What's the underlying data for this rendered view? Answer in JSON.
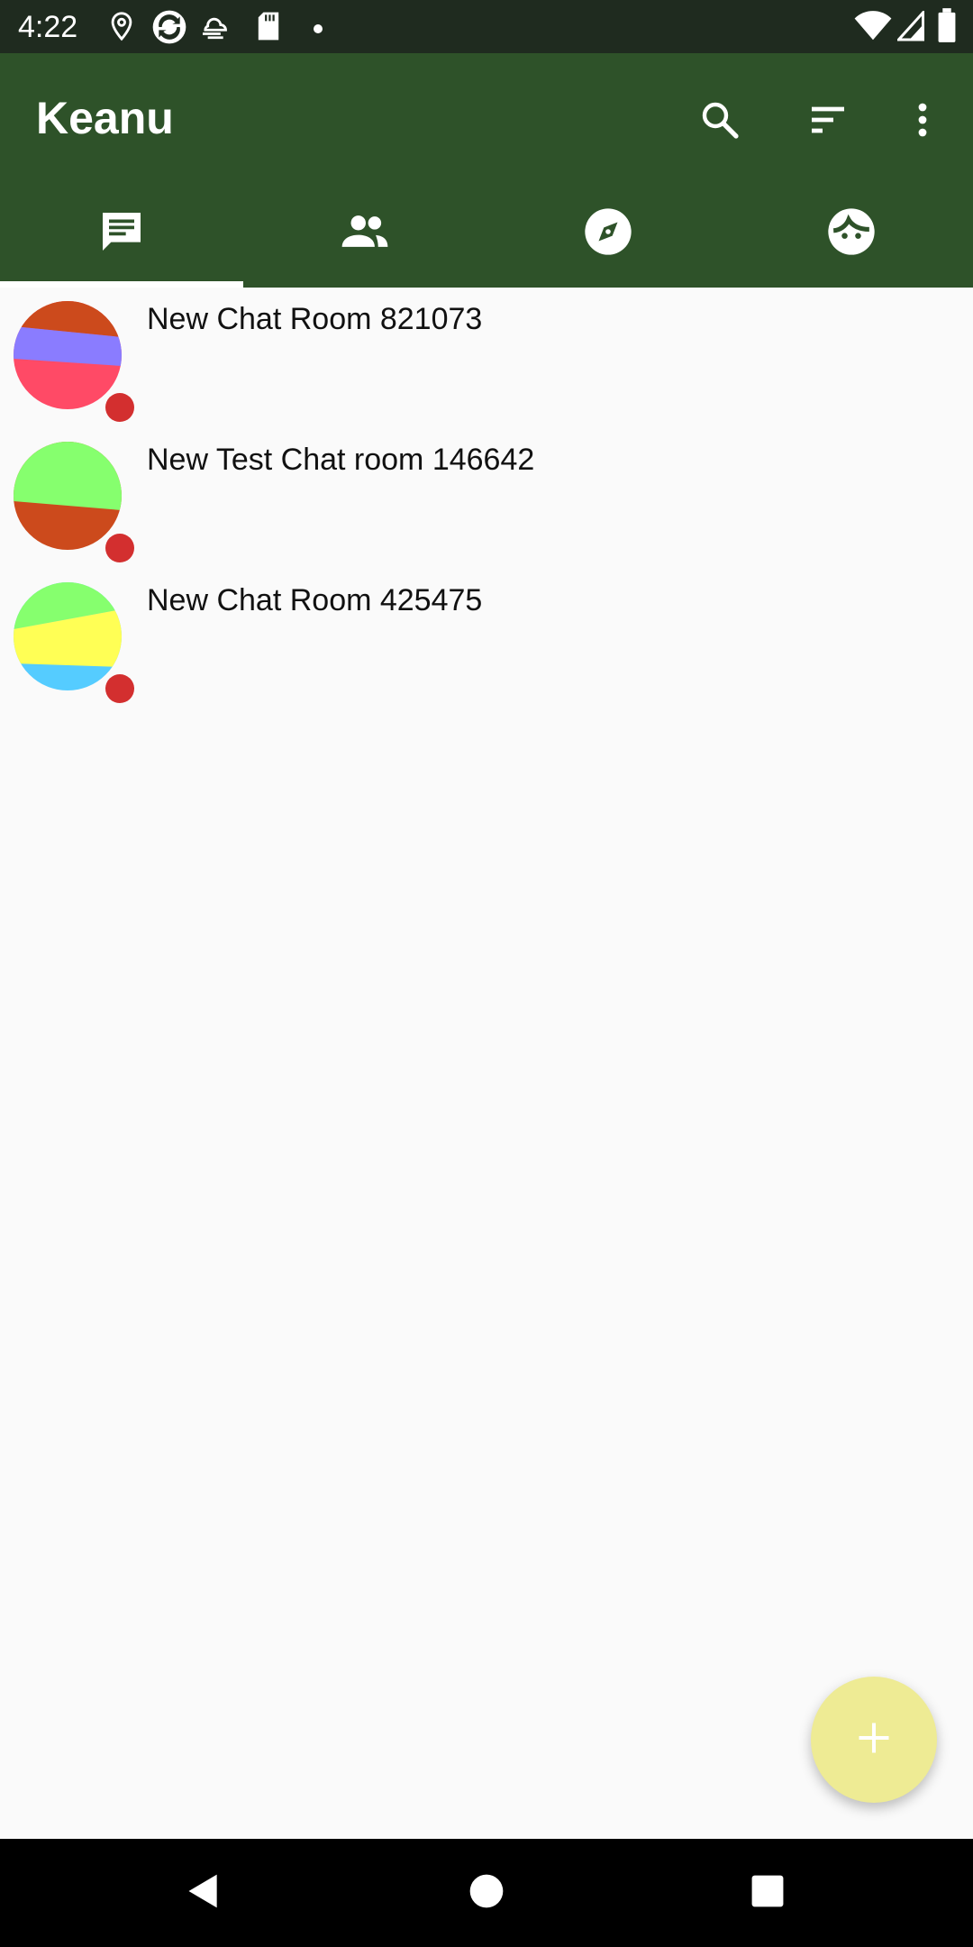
{
  "status_bar": {
    "time": "4:22",
    "left_icons": [
      "location-icon",
      "sync-app-icon",
      "cloud-wind-icon",
      "sd-card-icon",
      "notification-dot-icon"
    ],
    "right_icons": [
      "wifi-icon",
      "signal-icon",
      "battery-icon"
    ]
  },
  "app_bar": {
    "title": "Keanu",
    "actions": [
      "search-icon",
      "sort-icon",
      "more-vert-icon"
    ],
    "color": "#2e5229"
  },
  "tabs": [
    {
      "icon": "chat-icon",
      "selected": true
    },
    {
      "icon": "contacts-icon",
      "selected": false
    },
    {
      "icon": "explore-icon",
      "selected": false
    },
    {
      "icon": "profile-face-icon",
      "selected": false
    }
  ],
  "rooms": [
    {
      "name": "New Chat Room 821073",
      "unread": true,
      "avatar_colors": [
        "#cc4a1c",
        "#8a7cff",
        "#ff4a66"
      ]
    },
    {
      "name": "New Test Chat room 146642",
      "unread": true,
      "avatar_colors": [
        "#86ff6e",
        "#cc4a1c"
      ]
    },
    {
      "name": "New Chat Room 425475",
      "unread": true,
      "avatar_colors": [
        "#86ff6e",
        "#ffff55",
        "#55ccff"
      ]
    }
  ],
  "fab": {
    "icon": "add-icon",
    "color": "#eeeb94"
  },
  "nav_bar": {
    "buttons": [
      "back-icon",
      "home-icon",
      "recents-icon"
    ]
  }
}
